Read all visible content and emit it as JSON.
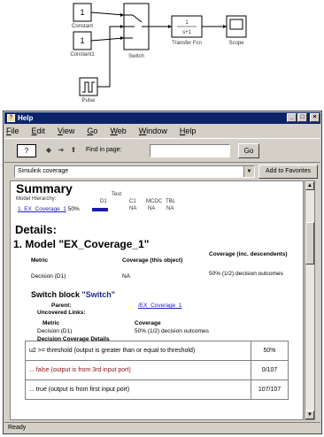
{
  "diagram": {
    "blocks": {
      "constant_value": "1",
      "constant_label": "Constant",
      "constant1_value": "1",
      "constant1_label": "Constant1",
      "switch_label": "Switch",
      "transfer_label": "Transfer Fcn",
      "transfer_num": "1",
      "transfer_den": "s+1",
      "scope_label": "Scope",
      "pulse_label": "Pulse"
    }
  },
  "window": {
    "title": "Help",
    "controls": {
      "minimize": "_",
      "maximize": "□",
      "close": "×"
    },
    "menu": [
      "File",
      "Edit",
      "View",
      "Go",
      "Web",
      "Window",
      "Help"
    ],
    "toolbar": {
      "nav_button": "?",
      "back_arrow": "◆",
      "forward_arrow": "➜",
      "home_arrow": "⬆",
      "find_label": "Find in page:",
      "find_value": "",
      "go_label": "Go"
    },
    "address": {
      "value": "Simulink coverage",
      "add_favorites": "Add to Favorites"
    },
    "status": "Ready"
  },
  "report": {
    "summary_title": "Summary",
    "model_hierarchy": "Model Hierarchy:",
    "test_label": "Test",
    "col_d1": "D1",
    "col_c1": "C1",
    "col_mcdc": "MCDC",
    "col_tbl": "TBL",
    "row_label": "1. EX_Coverage_1",
    "row_pct": "50%",
    "row_na_c1": "NA",
    "row_na_mcdc": "NA",
    "row_na_tbl": "NA",
    "coverage_fraction": 0.5,
    "details_title": "Details:",
    "model_title": "1. Model \"EX_Coverage_1\"",
    "metric_header": "Metric",
    "coverage_this_object": "Coverage (this object)",
    "coverage_descendents": "Coverage (inc. descendents)",
    "metric_row": "Decision (D1)",
    "metric_row_value": "NA",
    "metric_row_desc": "50% (1/2) decision outcomes",
    "switch_block_label": "Switch block",
    "switch_block_name": "\"Switch\"",
    "parent_label": "Parent:",
    "parent_value": "/EX_Coverage_1",
    "uncovered_label": "Uncovered Links:",
    "metric_label2": "Metric",
    "coverage_label2": "Coverage",
    "decision_row": "Decision (D1)",
    "decision_value": "50% (1/2) decision outcomes",
    "dc_details": "Decision Coverage Details",
    "table": [
      {
        "text": "u2 >= threshold (output is greater than or equal to threshold)",
        "pct": "50%",
        "red": false
      },
      {
        "text": "... false (output is from 3rd input port)",
        "pct": "0/107",
        "red": true
      },
      {
        "text": "... true (output is from first input port)",
        "pct": "107/107",
        "red": false
      }
    ]
  }
}
